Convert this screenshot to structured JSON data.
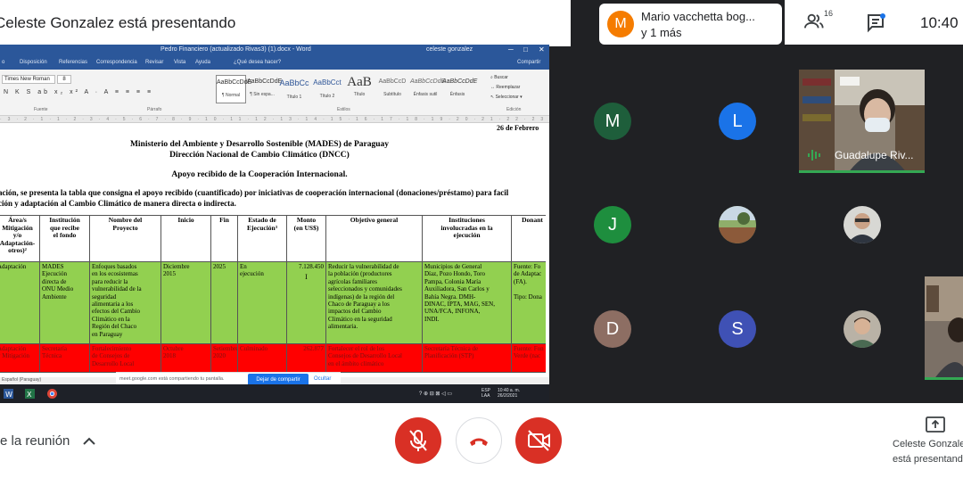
{
  "meeting": {
    "presenting_banner": "Celeste Gonzalez está presentando",
    "clock": "10:40",
    "participant_count": "16",
    "speaking_chip": {
      "avatar_letter": "M",
      "name": "Mario vacchetta bog...",
      "more": "y 1 más"
    }
  },
  "shared_window": {
    "title": "Pedro Financiero (actualizado Rivas3) (1).docx - Word",
    "user": "celeste gonzalez",
    "tabs": [
      "o",
      "Disposición",
      "Referencias",
      "Correspondencia",
      "Revisar",
      "Vista",
      "Ayuda",
      "¿Qué desea hacer?",
      "Compartir"
    ],
    "font_name": "Times New Roman",
    "font_size": "8",
    "ribbon_groups": [
      "Fuente",
      "Párrafo",
      "Estilos",
      "Edición"
    ],
    "styles": [
      {
        "preview": "AaBbCcDdE",
        "label": "¶ Normal"
      },
      {
        "preview": "AaBbCcDdE",
        "label": "¶ Sin espa..."
      },
      {
        "preview": "AaBbCc",
        "label": "Título 1"
      },
      {
        "preview": "AaBbCct",
        "label": "Título 2"
      },
      {
        "preview": "AaB",
        "label": "Título"
      },
      {
        "preview": "AaBbCcD",
        "label": "Subtítulo"
      },
      {
        "preview": "AaBbCcDdE",
        "label": "Énfasis sutil"
      },
      {
        "preview": "AaBbCcDdE",
        "label": "Énfasis"
      }
    ],
    "editing": [
      "Buscar",
      "Reemplazar",
      "Seleccionar"
    ],
    "document": {
      "date": "26 de Febrero",
      "heading1": "Ministerio del Ambiente y Desarrollo Sostenible (MADES) de Paraguay",
      "heading2": "Dirección Nacional de Cambio Climático (DNCC)",
      "heading3": "Apoyo recibido de la Cooperación Internacional.",
      "para1": "ación, se presenta la tabla que consigna el apoyo recibido (cuantificado) por iniciativas de cooperación internacional (donaciones/préstamo) para facil",
      "para2": "ción y adaptación al Cambio Climático de manera directa o indirecta.",
      "table_headers": [
        "Área/s\nMitigación\ny/o\nAdaptación-\notros)²",
        "Institución\nque recibe\nel fondo",
        "Nombre del\nProyecto",
        "Inicio",
        "Fin",
        "Estado de\nEjecución³",
        "Monto\n(en US$)",
        "Objetivo general",
        "Instituciones\ninvolucradas en la\nejecución",
        "Donant"
      ],
      "row_green": [
        "Adaptación",
        "MADES\nEjecución\ndirecta de\nONU Medio\nAmbiente",
        "Enfoques basados\nen los ecosistemas\npara reducir la\nvulnerabilidad de la\nseguridad\nalimentaria a los\nefectos del Cambio\nClimático en la\nRegión del Chaco\nen Paraguay",
        "Diciembre\n2015",
        "2025",
        "En\nejecución",
        "7.128.450",
        "Reducir la vulnerabilidad de\nla población (productores\nagrícolas familiares\nseleccionados y comunidades\nindígenas) de la región del\nChaco de Paraguay a los\nimpactos del Cambio\nClimático en la seguridad\nalimentaria.",
        "Municipios de General\nDíaz, Pozo Hondo, Toro\nPampa, Colonia María\nAuxiliadora, San Carlos y\nBahía Negra. DMH-\nDINAC, IPTA, MAG, SEN,\nUNA/FCA, INFONA,\nINDI.",
        "Fuente: Fo\nde Adaptac\n(FA).\n\nTipo: Dona"
      ],
      "row_red": [
        "Adaptación\ny Mitigación",
        "Secretaría\nTécnica",
        "Fortalecimiento\nde Consejos de\nDesarrollo Local",
        "Octubre\n2018",
        "Setiembre\n2020",
        "Culminado",
        "262.877",
        "Fortalecer el rol de los\nConsejos de Desarrollo Local\nen el ámbito climático",
        "Secretaría Técnica de\nPlanificación (STP)",
        "Fuente: Fon\nVerde (nac"
      ],
      "cursor_mark": "I"
    },
    "share_notice": "meet.google.com está compartiendo tu pantalla.",
    "stop_sharing": "Dejar de compartir",
    "hide": "Ocultar",
    "status": "Español (Paraguay)",
    "tray": "ESP",
    "tray2": "LAA",
    "time": "10:40 a. m.",
    "date": "26/2/2021"
  },
  "participants": [
    {
      "letter": "M",
      "color": "#1e5e3b"
    },
    {
      "letter": "L",
      "color": "#1a73e8"
    },
    {
      "letter": "J",
      "color": "#1e8e3e"
    },
    {
      "letter": "D",
      "color": "#8d6e63"
    },
    {
      "letter": "S",
      "color": "#3f51b5"
    }
  ],
  "video_tile": {
    "name": "Guadalupe Riv..."
  },
  "bottom": {
    "meeting_details": "e la reunión",
    "presenter_name": "Celeste Gonzalez",
    "presenter_state": "está presentando"
  }
}
